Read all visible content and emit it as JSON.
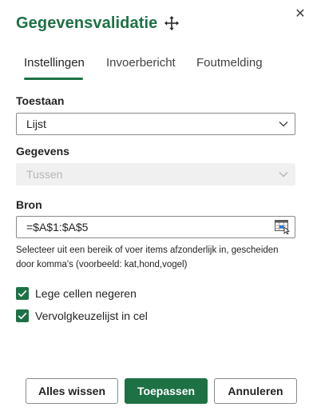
{
  "dialog": {
    "title": "Gegevensvalidatie",
    "close_icon": "close-icon",
    "move_icon": "move-icon"
  },
  "tabs": [
    {
      "label": "Instellingen",
      "active": true
    },
    {
      "label": "Invoerbericht",
      "active": false
    },
    {
      "label": "Foutmelding",
      "active": false
    }
  ],
  "allow": {
    "label": "Toestaan",
    "value": "Lijst"
  },
  "data": {
    "label": "Gegevens",
    "value": "Tussen",
    "disabled": true
  },
  "source": {
    "label": "Bron",
    "value": "=$A$1:$A$5",
    "icon": "range-select-icon",
    "help": "Selecteer uit een bereik of voer items afzonderlijk in, gescheiden door komma's (voorbeeld: kat,hond,vogel)"
  },
  "checkboxes": [
    {
      "label": "Lege cellen negeren",
      "checked": true
    },
    {
      "label": "Vervolgkeuzelijst in cel",
      "checked": true
    }
  ],
  "buttons": {
    "clear": "Alles wissen",
    "apply": "Toepassen",
    "cancel": "Annuleren"
  },
  "colors": {
    "accent": "#1e7145",
    "text": "#242424",
    "border": "#8a8a8a",
    "disabled_bg": "#f0f0f0"
  }
}
